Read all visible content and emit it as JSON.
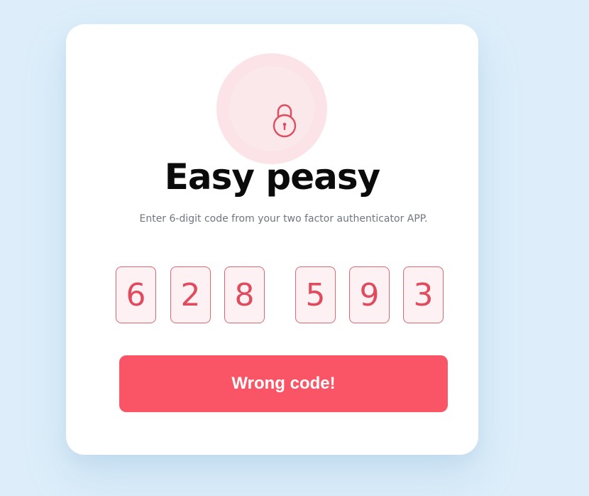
{
  "header": {
    "title": "Easy peasy",
    "subtitle": "Enter 6-digit code from your two factor authenticator APP."
  },
  "lock_icon": "lock-icon",
  "code": {
    "digits": [
      "6",
      "2",
      "8",
      "5",
      "9",
      "3"
    ]
  },
  "action": {
    "button_label": "Wrong code!"
  },
  "colors": {
    "background": "#ddeefa",
    "card": "#ffffff",
    "accent": "#fa5566",
    "digit_border": "#e06674",
    "digit_text": "#e04b5e",
    "lock_circle": "#fbe3e7"
  }
}
